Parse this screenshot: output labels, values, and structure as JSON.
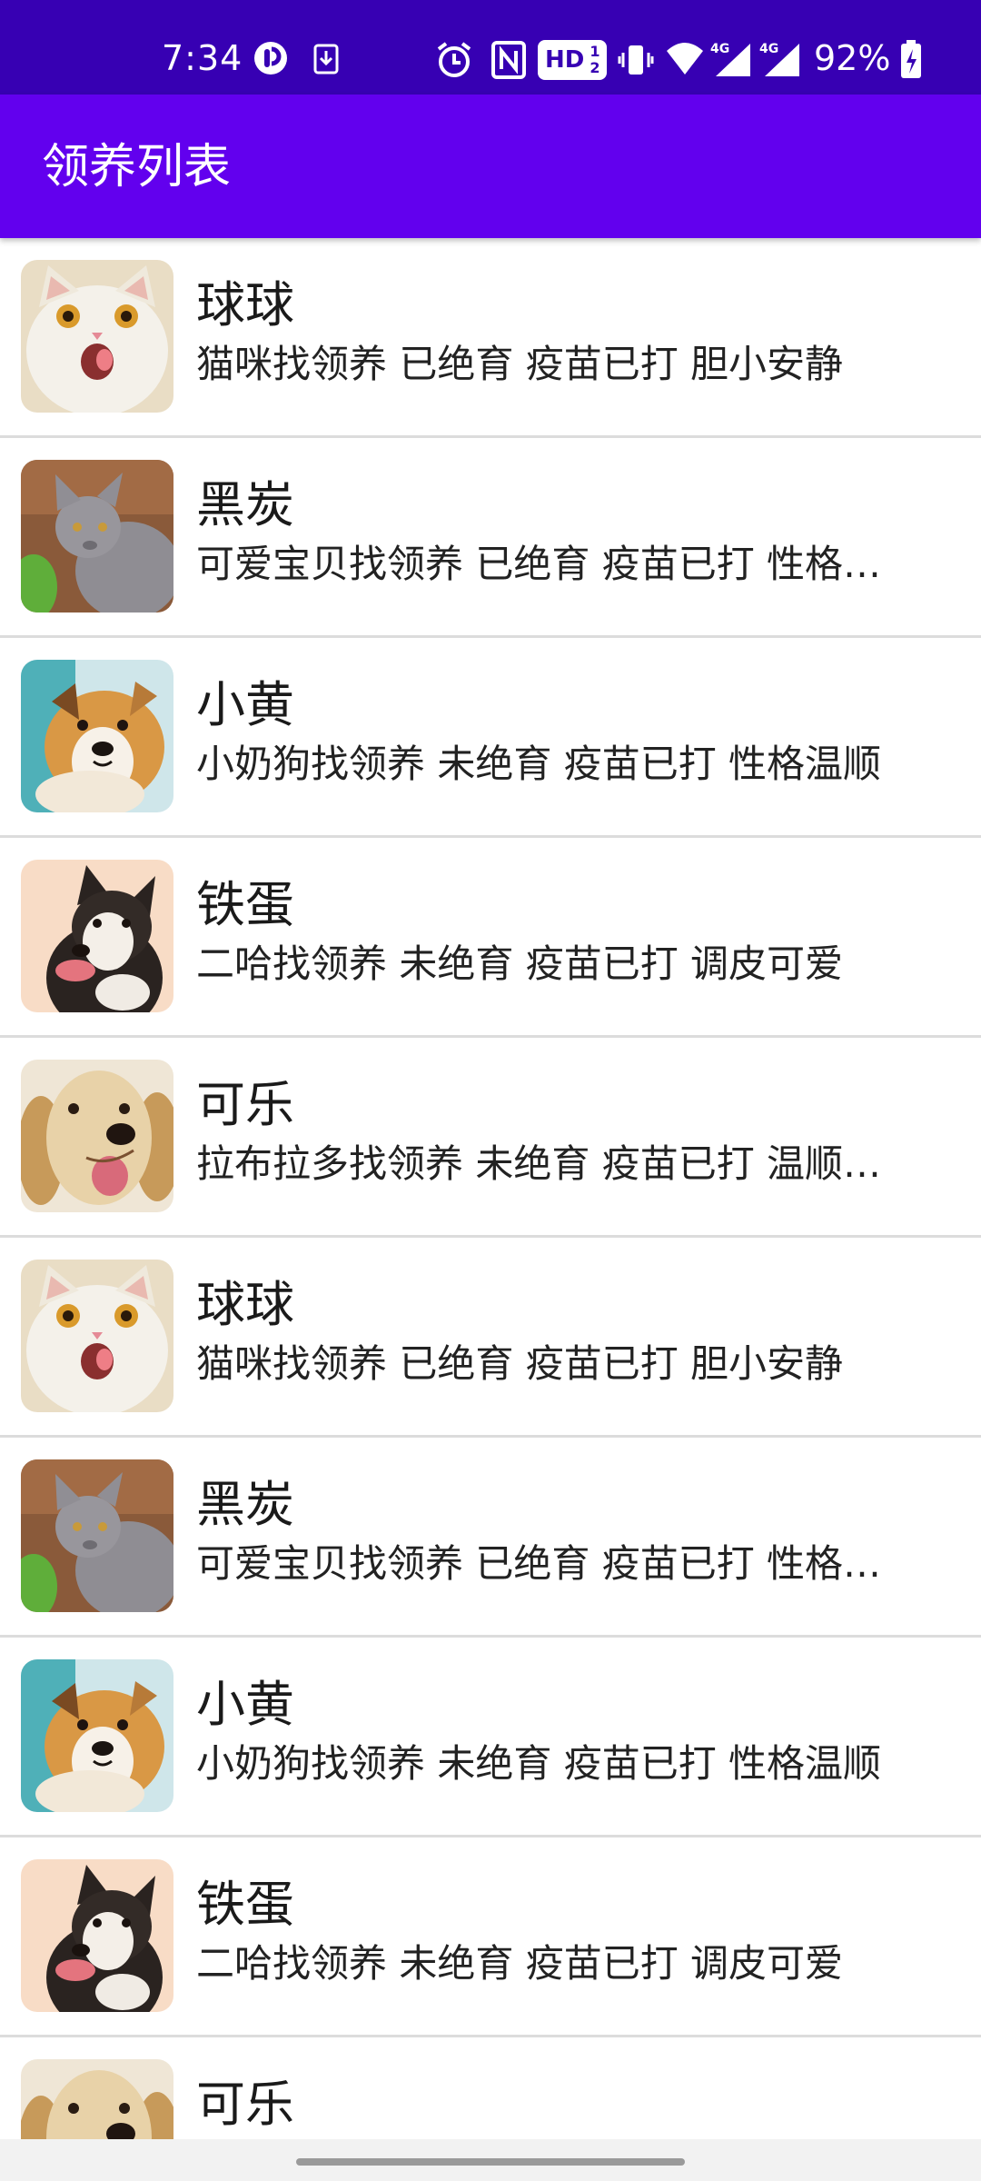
{
  "status_bar": {
    "time": "7:34",
    "hd_label": "HD",
    "hd_sub": "1 2",
    "signal_label_1": "4G",
    "signal_label_2": "4G",
    "battery": "92%",
    "icons": [
      "app-notification-icon",
      "download-icon",
      "alarm-icon",
      "nfc-icon",
      "hd-voice-icon",
      "vibrate-icon",
      "wifi-icon",
      "signal-icon",
      "signal-icon",
      "battery-charging-icon"
    ]
  },
  "app_bar": {
    "title": "领养列表",
    "color": "#6200ee"
  },
  "pets": [
    {
      "name": "球球",
      "desc": "猫咪找领养 已绝育 疫苗已打 胆小安静",
      "photo": "white-cat"
    },
    {
      "name": "黑炭",
      "desc": "可爱宝贝找领养 已绝育 疫苗已打 性格…",
      "photo": "grey-cat"
    },
    {
      "name": "小黄",
      "desc": "小奶狗找领养 未绝育 疫苗已打 性格温顺",
      "photo": "puppy"
    },
    {
      "name": "铁蛋",
      "desc": "二哈找领养 未绝育 疫苗已打 调皮可爱",
      "photo": "husky"
    },
    {
      "name": "可乐",
      "desc": "拉布拉多找领养 未绝育 疫苗已打 温顺…",
      "photo": "golden-retriever"
    },
    {
      "name": "球球",
      "desc": "猫咪找领养 已绝育 疫苗已打 胆小安静",
      "photo": "white-cat"
    },
    {
      "name": "黑炭",
      "desc": "可爱宝贝找领养 已绝育 疫苗已打 性格…",
      "photo": "grey-cat"
    },
    {
      "name": "小黄",
      "desc": "小奶狗找领养 未绝育 疫苗已打 性格温顺",
      "photo": "puppy"
    },
    {
      "name": "铁蛋",
      "desc": "二哈找领养 未绝育 疫苗已打 调皮可爱",
      "photo": "husky"
    },
    {
      "name": "可乐",
      "desc": "",
      "photo": "golden-retriever"
    }
  ]
}
